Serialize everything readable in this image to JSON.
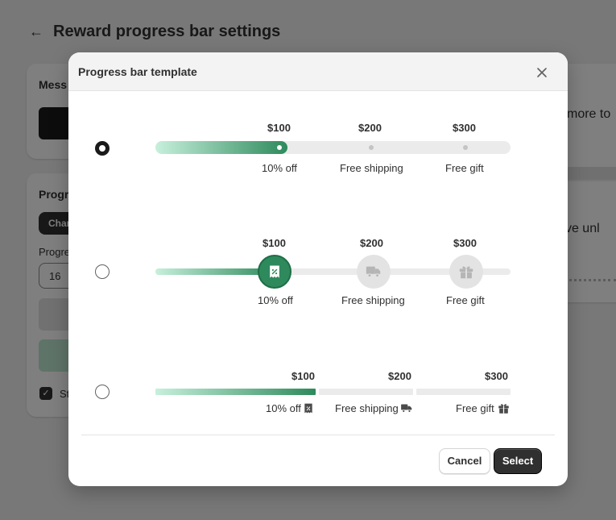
{
  "page": {
    "title": "Reward progress bar settings",
    "bg_texts": {
      "message_title": "Mess",
      "progress_title": "Progr",
      "chip": "Char",
      "progress_label": "Progre",
      "input_value": "16",
      "checkbox_label": "St",
      "right_text_1": "more to",
      "right_text_2": "u've unl"
    }
  },
  "modal": {
    "title": "Progress bar template",
    "cancel_label": "Cancel",
    "select_label": "Select",
    "selected_index": 0
  },
  "templates": [
    {
      "style": "dots",
      "progress": 0.35,
      "milestones": [
        {
          "amount": "$100",
          "label": "10% off",
          "icon": "discount-icon",
          "reached": true
        },
        {
          "amount": "$200",
          "label": "Free shipping",
          "icon": "truck-icon",
          "reached": false
        },
        {
          "amount": "$300",
          "label": "Free gift",
          "icon": "gift-icon",
          "reached": false
        }
      ]
    },
    {
      "style": "icon-circles",
      "progress": 0.34,
      "milestones": [
        {
          "amount": "$100",
          "label": "10% off",
          "icon": "discount-icon",
          "reached": true
        },
        {
          "amount": "$200",
          "label": "Free shipping",
          "icon": "truck-icon",
          "reached": false
        },
        {
          "amount": "$300",
          "label": "Free gift",
          "icon": "gift-icon",
          "reached": false
        }
      ]
    },
    {
      "style": "segments",
      "progress": 0.45,
      "milestones": [
        {
          "amount": "$100",
          "label": "10% off",
          "icon": "discount-icon",
          "reached": true
        },
        {
          "amount": "$200",
          "label": "Free shipping",
          "icon": "truck-icon",
          "reached": false
        },
        {
          "amount": "$300",
          "label": "Free gift",
          "icon": "gift-icon",
          "reached": false
        }
      ]
    }
  ],
  "colors": {
    "accent_green": "#2e8a5c",
    "light_green": "#c7f0dc",
    "track_grey": "#ebebeb",
    "button_dark": "#303030"
  }
}
